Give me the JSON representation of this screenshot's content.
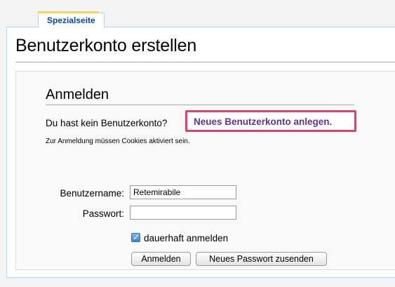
{
  "tab": {
    "label": "Spezialseite"
  },
  "page": {
    "title": "Benutzerkonto erstellen"
  },
  "login": {
    "section_title": "Anmelden",
    "no_account_text": "Du hast kein Benutzerkonto?",
    "create_account_link": "Neues Benutzerkonto anlegen.",
    "cookie_note": "Zur Anmeldung müssen Cookies aktiviert sein.",
    "username_label": "Benutzername:",
    "username_value": "Retemirabile",
    "password_label": "Passwort:",
    "password_value": "",
    "remember_label": "dauerhaft anmelden",
    "remember_checked": true,
    "login_button": "Anmelden",
    "reset_button": "Neues Passwort zusenden"
  },
  "colors": {
    "link": "#5a3696",
    "highlight": "#e83d6a",
    "tab_link": "#0645ad"
  }
}
